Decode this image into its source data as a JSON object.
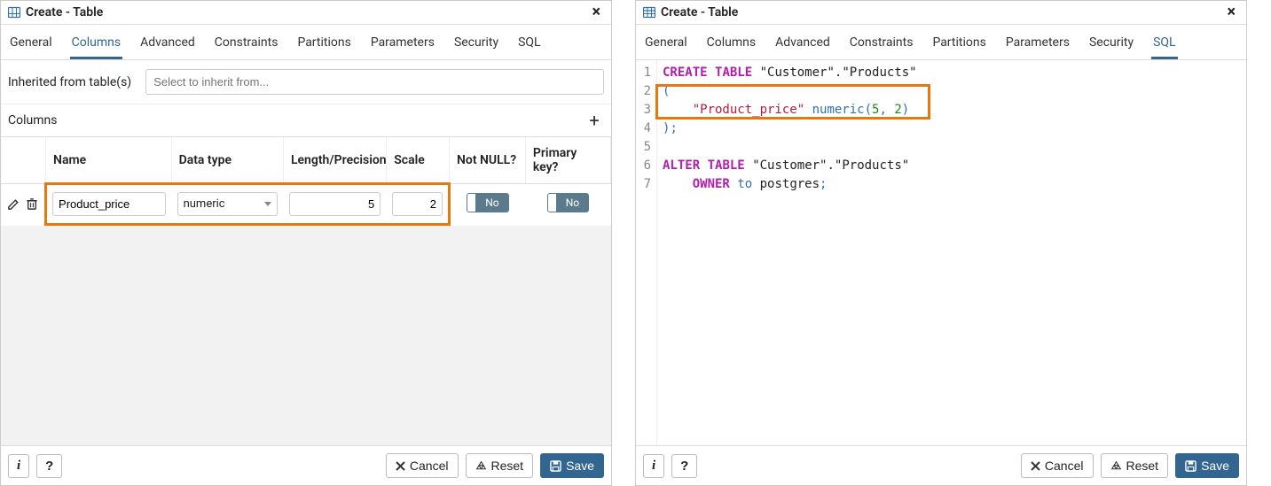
{
  "dialog": {
    "title": "Create - Table"
  },
  "left": {
    "tabs": [
      "General",
      "Columns",
      "Advanced",
      "Constraints",
      "Partitions",
      "Parameters",
      "Security",
      "SQL"
    ],
    "active_tab": "Columns",
    "inherit_label": "Inherited from table(s)",
    "inherit_placeholder": "Select to inherit from...",
    "columns_section_title": "Columns",
    "headers": {
      "name": "Name",
      "datatype": "Data type",
      "length": "Length/Precision",
      "scale": "Scale",
      "notnull": "Not NULL?",
      "pk": "Primary key?"
    },
    "rows": [
      {
        "name": "Product_price",
        "datatype": "numeric",
        "length": "5",
        "scale": "2",
        "notnull_label": "No",
        "pk_label": "No"
      }
    ]
  },
  "right": {
    "tabs": [
      "General",
      "Columns",
      "Advanced",
      "Constraints",
      "Partitions",
      "Parameters",
      "Security",
      "SQL"
    ],
    "active_tab": "SQL",
    "sql": {
      "line1": {
        "kw1": "CREATE",
        "kw2": "TABLE",
        "ident": "\"Customer\".\"Products\""
      },
      "line2": {
        "pun": "("
      },
      "line3": {
        "str": "\"Product_price\"",
        "typ": "numeric",
        "open": "(",
        "n1": "5",
        "comma": ",",
        "n2": "2",
        "close": ")"
      },
      "line4": {
        "pun1": ")",
        "pun2": ";"
      },
      "line6": {
        "kw1": "ALTER",
        "kw2": "TABLE",
        "ident": "\"Customer\".\"Products\""
      },
      "line7": {
        "kw1": "OWNER",
        "kw2": "to",
        "ident": "postgres",
        "pun": ";"
      },
      "line_numbers": [
        "1",
        "2",
        "3",
        "4",
        "5",
        "6",
        "7"
      ]
    }
  },
  "footer": {
    "info": "i",
    "help": "?",
    "cancel": "Cancel",
    "reset": "Reset",
    "save": "Save"
  }
}
